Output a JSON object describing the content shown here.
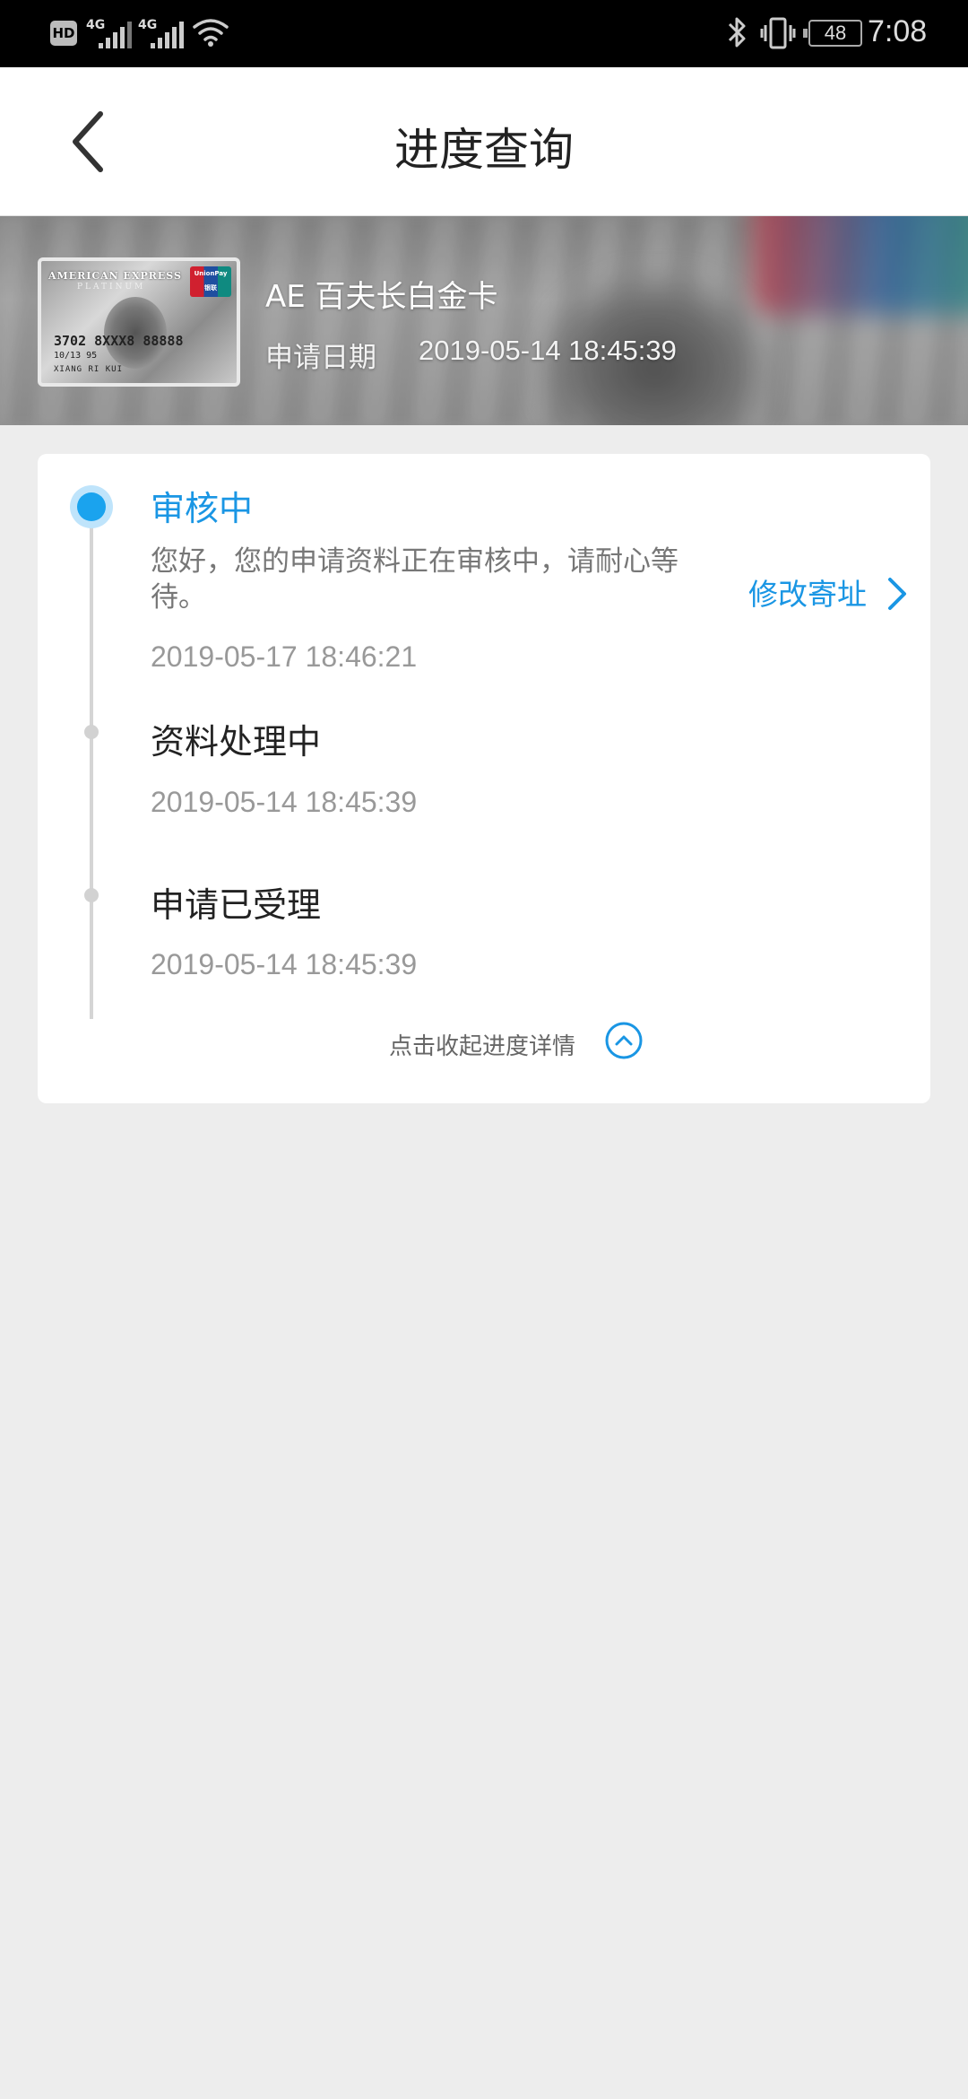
{
  "status_bar": {
    "hd": "HD",
    "net1": "4G",
    "net2": "4G",
    "battery": "48",
    "time": "7:08"
  },
  "header": {
    "title": "进度查询"
  },
  "card": {
    "brand_text": "AMERICAN EXPRESS",
    "tier_text": "PLATINUM",
    "unionpay_text": "UnionPay 银联",
    "number_text": "3702 8XXX8 88888",
    "expiry_text": "10/13   95",
    "holder_text": "XIANG RI KUI",
    "name": "AE 百夫长白金卡",
    "apply_label": "申请日期",
    "apply_date": "2019-05-14 18:45:39"
  },
  "progress": {
    "steps": [
      {
        "title": "审核中",
        "desc": "您好，您的申请资料正在审核中，请耐心等待。",
        "time": "2019-05-17 18:46:21"
      },
      {
        "title": "资料处理中",
        "time": "2019-05-14 18:45:39"
      },
      {
        "title": "申请已受理",
        "time": "2019-05-14 18:45:39"
      }
    ],
    "modify_address": "修改寄址",
    "collapse_text": "点击收起进度详情"
  },
  "colors": {
    "accent": "#1a96e4",
    "background": "#ededed"
  }
}
